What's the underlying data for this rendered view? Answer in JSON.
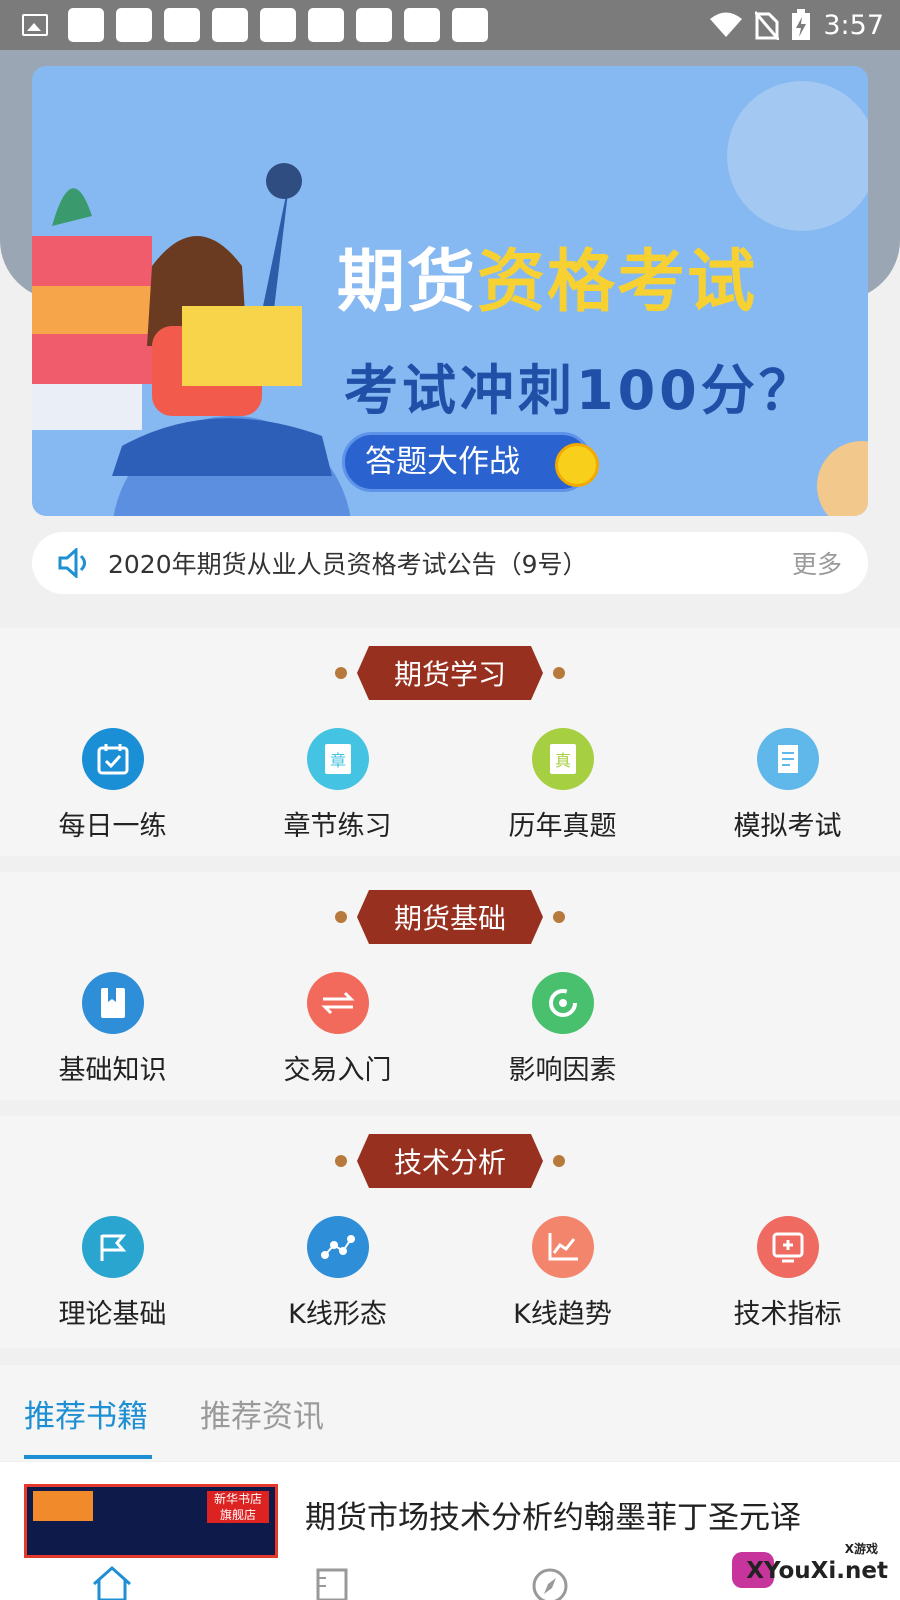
{
  "status_bar": {
    "time": "3:57",
    "icons": [
      "image-icon",
      "app-icon",
      "app-icon",
      "app-icon",
      "app-icon",
      "app-icon",
      "app-icon",
      "app-icon",
      "app-icon",
      "app-icon",
      "wifi-icon",
      "no-sim-icon",
      "battery-charging-icon"
    ]
  },
  "banner": {
    "title_main": "期货",
    "title_highlight": "资格考试",
    "subtitle": "考试冲刺100分？",
    "button_label": "答题大作战",
    "colors": {
      "bg": "#86b9f2",
      "highlight": "#f7d132",
      "subtitle": "#1f4fa6",
      "button": "#2a62cf"
    }
  },
  "notice": {
    "icon": "speaker-icon",
    "text": "2020年期货从业人员资格考试公告（9号）",
    "more": "更多"
  },
  "sections": [
    {
      "title": "期货学习",
      "items": [
        {
          "label": "每日一练",
          "icon": "calendar-check-icon",
          "color": "#1a8fd6"
        },
        {
          "label": "章节练习",
          "icon": "chapter-book-icon",
          "color": "#45c3e2"
        },
        {
          "label": "历年真题",
          "icon": "real-exam-icon",
          "color": "#a6cf42"
        },
        {
          "label": "模拟考试",
          "icon": "exam-scroll-icon",
          "color": "#5fb7ea"
        }
      ]
    },
    {
      "title": "期货基础",
      "items": [
        {
          "label": "基础知识",
          "icon": "book-bookmark-icon",
          "color": "#2f8ed8"
        },
        {
          "label": "交易入门",
          "icon": "exchange-arrows-icon",
          "color": "#f26a5b"
        },
        {
          "label": "影响因素",
          "icon": "ring-icon",
          "color": "#48c06e"
        }
      ]
    },
    {
      "title": "技术分析",
      "items": [
        {
          "label": "理论基础",
          "icon": "flag-icon",
          "color": "#2aa5cf"
        },
        {
          "label": "K线形态",
          "icon": "scatter-line-icon",
          "color": "#2f8ed8"
        },
        {
          "label": "K线趋势",
          "icon": "trend-chart-icon",
          "color": "#f3856c"
        },
        {
          "label": "技术指标",
          "icon": "indicator-screen-icon",
          "color": "#ef6a60"
        }
      ]
    }
  ],
  "tabs": [
    {
      "label": "推荐书籍",
      "active": true
    },
    {
      "label": "推荐资讯",
      "active": false
    }
  ],
  "book": {
    "title": "期货市场技术分析约翰墨菲丁圣元译",
    "cover_seal": "新华书店 旗舰店"
  },
  "bottom_nav": [
    "home-icon",
    "book-ruler-icon",
    "compass-icon"
  ],
  "watermark": {
    "tag": "X游戏",
    "text": "XYouXi.net"
  },
  "accent_color": "#1f8fd3",
  "ribbon_color": "#98301f"
}
